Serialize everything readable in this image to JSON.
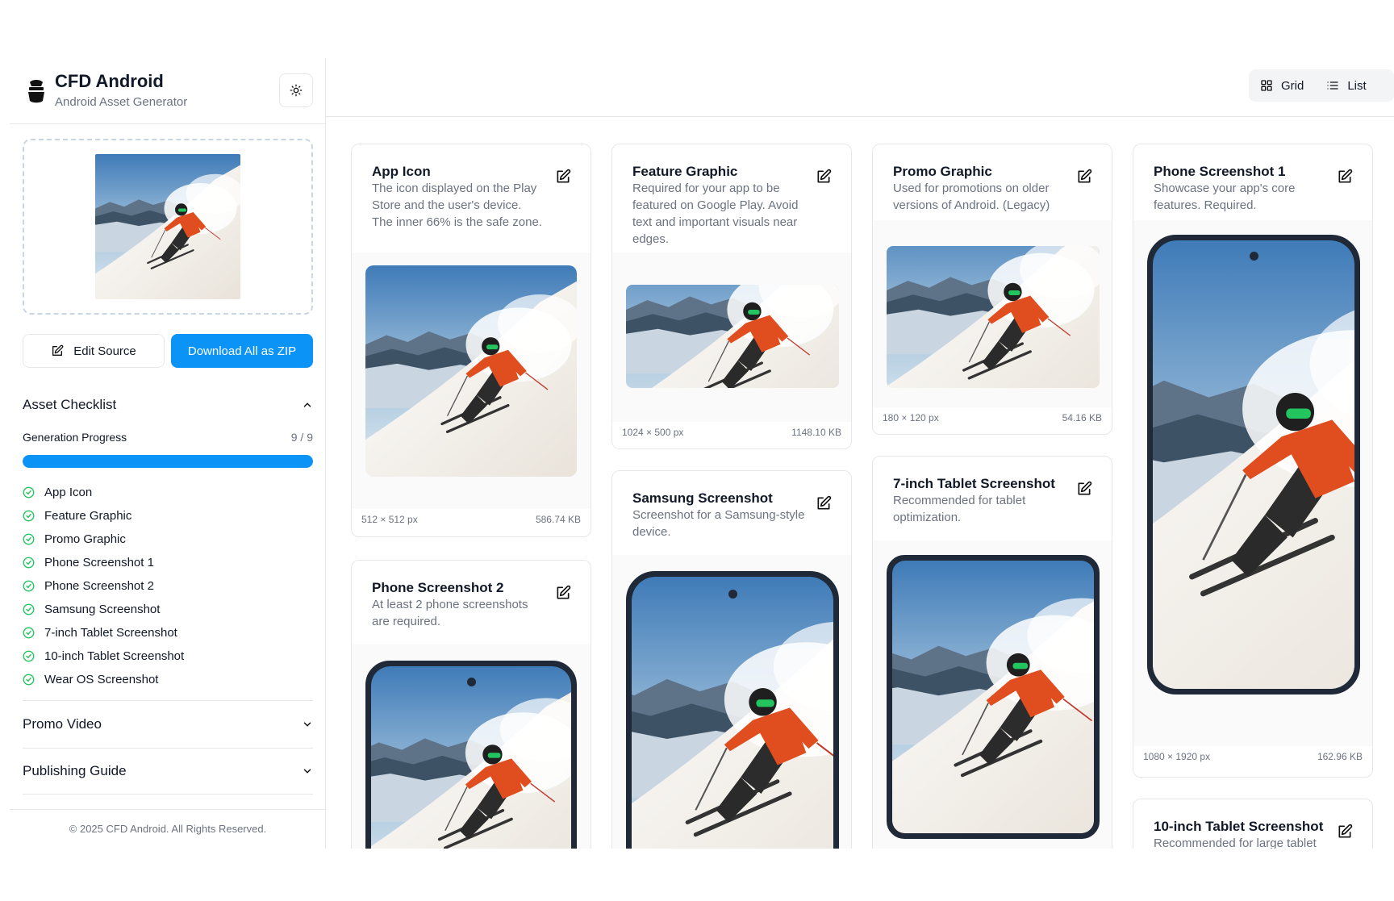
{
  "sidebar": {
    "title": "CFD Android",
    "subtitle": "Android Asset Generator",
    "edit_source_label": "Edit Source",
    "download_zip_label": "Download All as ZIP",
    "checklist_title": "Asset Checklist",
    "progress_label": "Generation Progress",
    "progress_count": "9 / 9",
    "progress_fraction": 1.0,
    "checklist_items": [
      "App Icon",
      "Feature Graphic",
      "Promo Graphic",
      "Phone Screenshot 1",
      "Phone Screenshot 2",
      "Samsung Screenshot",
      "7-inch Tablet Screenshot",
      "10-inch Tablet Screenshot",
      "Wear OS Screenshot"
    ],
    "promo_video_title": "Promo Video",
    "publishing_guide_title": "Publishing Guide",
    "footer": "© 2025 CFD Android. All Rights Reserved."
  },
  "toolbar": {
    "grid_label": "Grid",
    "list_label": "List"
  },
  "cards": {
    "app_icon": {
      "title": "App Icon",
      "desc": "The icon displayed on the Play Store and the user's device. The inner 66% is the safe zone.",
      "dims": "512 × 512 px",
      "size": "586.74 KB"
    },
    "feature_graphic": {
      "title": "Feature Graphic",
      "desc": "Required for your app to be featured on Google Play. Avoid text and important visuals near edges.",
      "dims": "1024 × 500 px",
      "size": "1148.10 KB"
    },
    "promo_graphic": {
      "title": "Promo Graphic",
      "desc": "Used for promotions on older versions of Android. (Legacy)",
      "dims": "180 × 120 px",
      "size": "54.16 KB"
    },
    "phone_1": {
      "title": "Phone Screenshot 1",
      "desc": "Showcase your app's core features. Required.",
      "dims": "1080 × 1920 px",
      "size": "162.96 KB"
    },
    "phone_2": {
      "title": "Phone Screenshot 2",
      "desc": "At least 2 phone screenshots are required."
    },
    "samsung": {
      "title": "Samsung Screenshot",
      "desc": "Screenshot for a Samsung-style device."
    },
    "tablet_7": {
      "title": "7-inch Tablet Screenshot",
      "desc": "Recommended for tablet optimization."
    },
    "tablet_10": {
      "title": "10-inch Tablet Screenshot",
      "desc": "Recommended for large tablet optimization."
    }
  },
  "colors": {
    "accent": "#0b93f6",
    "success": "#22c55e",
    "border": "#e5e7eb",
    "muted": "#6b7280"
  }
}
